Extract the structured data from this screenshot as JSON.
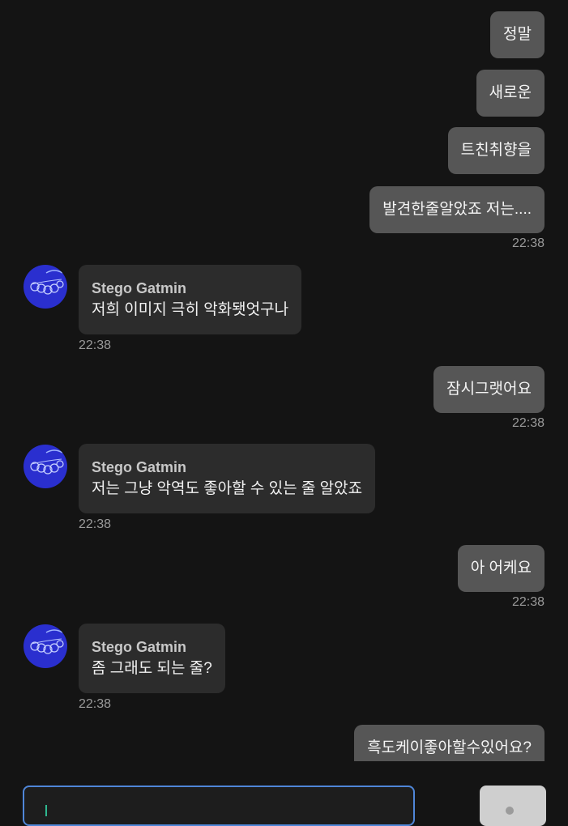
{
  "messages": [
    {
      "type": "out",
      "text": "정말"
    },
    {
      "type": "out",
      "text": "새로운"
    },
    {
      "type": "out",
      "text": "트친취향을"
    },
    {
      "type": "out",
      "text": "발견한줄알았죠 저는...."
    },
    {
      "type": "time",
      "text": "22:38"
    },
    {
      "type": "in",
      "sender": "Stego Gatmin",
      "text": "저희 이미지 극히 악화됏엇구나",
      "time": "22:38"
    },
    {
      "type": "out",
      "text": "잠시그랫어요",
      "time": "22:38"
    },
    {
      "type": "in",
      "sender": "Stego Gatmin",
      "text": "저는 그냥 악역도 좋아할 수 있는 줄 알았죠",
      "time": "22:38"
    },
    {
      "type": "out",
      "text": "아 어케요",
      "time": "22:38"
    },
    {
      "type": "in",
      "sender": "Stego Gatmin",
      "text": "좀 그래도 되는 줄?",
      "time": "22:38"
    },
    {
      "type": "out",
      "text": "흑도케이좋아할수있어요?"
    }
  ],
  "colors": {
    "background": "#141414",
    "outgoing_bubble": "#565656",
    "incoming_bubble": "#2c2c2c",
    "avatar": "#2a2fcf",
    "input_border": "#4f86d8"
  },
  "icons": {
    "avatar": "blue-doodle-avatar-icon",
    "send": "send-icon"
  }
}
